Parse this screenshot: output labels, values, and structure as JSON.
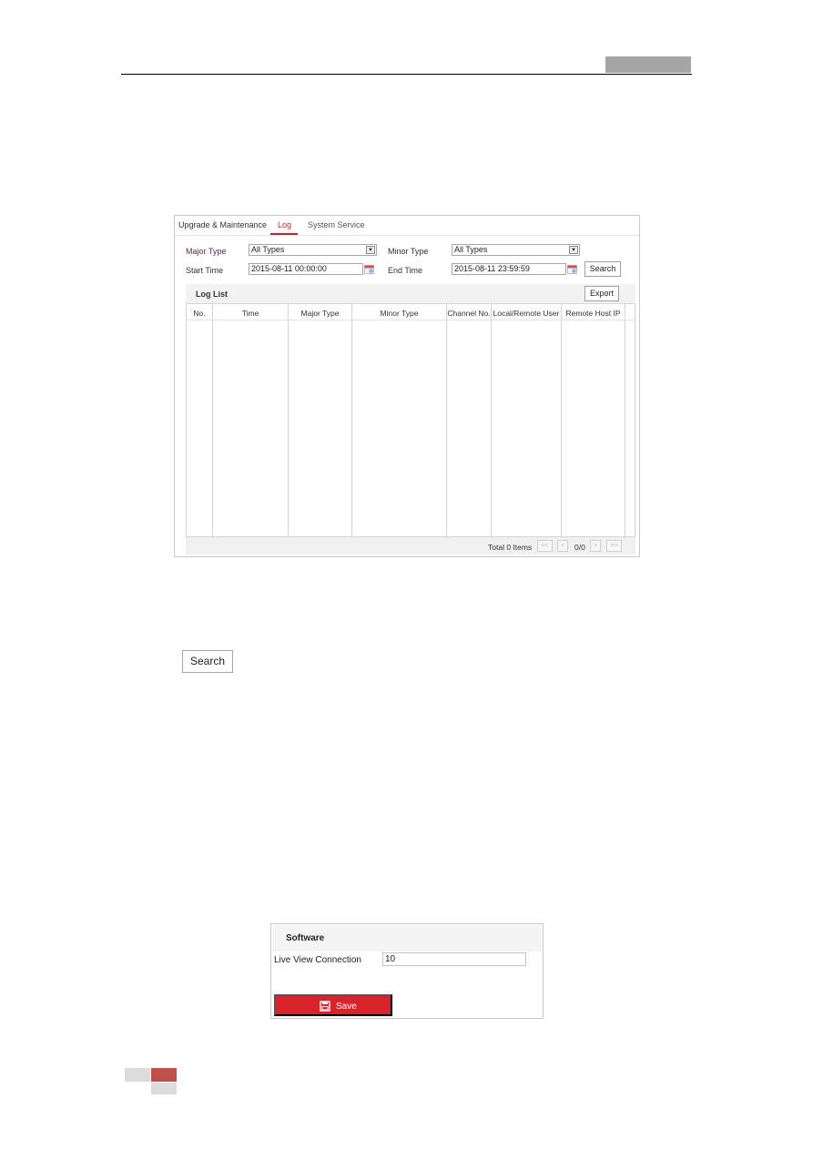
{
  "log_panel": {
    "tabs": [
      {
        "label": "Upgrade & Maintenance",
        "active": false
      },
      {
        "label": "Log",
        "active": true
      },
      {
        "label": "System Service",
        "active": false
      }
    ],
    "major_type": {
      "label": "Major Type",
      "value": "All Types"
    },
    "minor_type": {
      "label": "Minor Type",
      "value": "All Types"
    },
    "start_time": {
      "label": "Start Time",
      "value": "2015-08-11 00:00:00"
    },
    "end_time": {
      "label": "End Time",
      "value": "2015-08-11 23:59:59"
    },
    "search_label": "Search",
    "log_list": {
      "title": "Log List",
      "export_label": "Export",
      "columns": [
        "No.",
        "Time",
        "Major Type",
        "Minor Type",
        "Channel No.",
        "Local/Remote User",
        "Remote Host IP"
      ],
      "rows": [],
      "total_label": "Total 0 Items",
      "page_count": "0/0",
      "pager": {
        "first": "<<",
        "prev": "<",
        "next": ">",
        "last": ">>"
      }
    }
  },
  "standalone_search": {
    "label": "Search"
  },
  "software_panel": {
    "title": "Software",
    "live_view_label": "Live View Connection",
    "live_view_value": "10",
    "save_label": "Save"
  },
  "colors": {
    "accent_red": "#d9232b",
    "tab_active": "#c0272d",
    "page_marker": "#c0504d"
  }
}
